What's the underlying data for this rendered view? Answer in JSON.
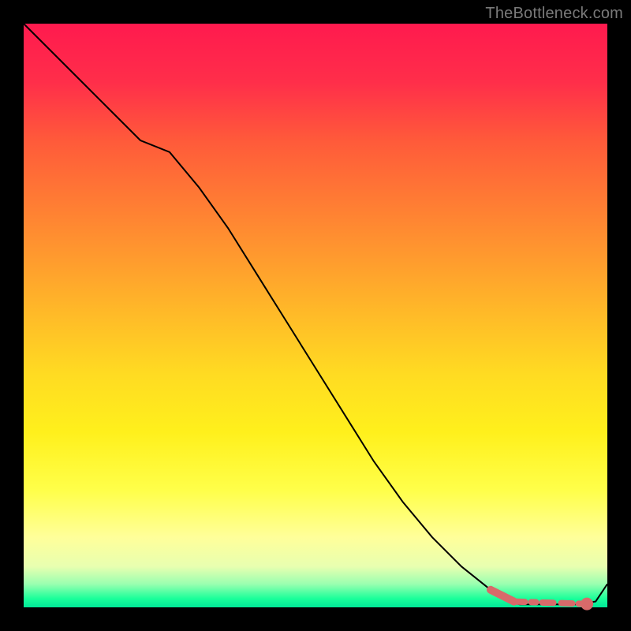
{
  "attribution": "TheBottleneck.com",
  "chart_data": {
    "type": "line",
    "title": "",
    "xlabel": "",
    "ylabel": "",
    "xlim": [
      0,
      100
    ],
    "ylim": [
      0,
      100
    ],
    "series": [
      {
        "name": "main-curve",
        "x": [
          0,
          5,
          10,
          15,
          20,
          25,
          30,
          35,
          40,
          45,
          50,
          55,
          60,
          65,
          70,
          75,
          80,
          83,
          85,
          90,
          95,
          98,
          100
        ],
        "values": [
          100,
          95,
          90,
          85,
          80,
          78,
          72,
          65,
          57,
          49,
          41,
          33,
          25,
          18,
          12,
          7,
          3,
          1,
          0.5,
          0.5,
          0.5,
          1,
          4
        ]
      }
    ],
    "highlight": {
      "solid_segment": {
        "x": [
          80,
          84
        ],
        "values": [
          3,
          1
        ]
      },
      "dashed_segment": {
        "x": [
          84,
          96
        ],
        "values": [
          1,
          0.6
        ]
      },
      "point": {
        "x": 96.5,
        "y": 0.6
      }
    }
  }
}
